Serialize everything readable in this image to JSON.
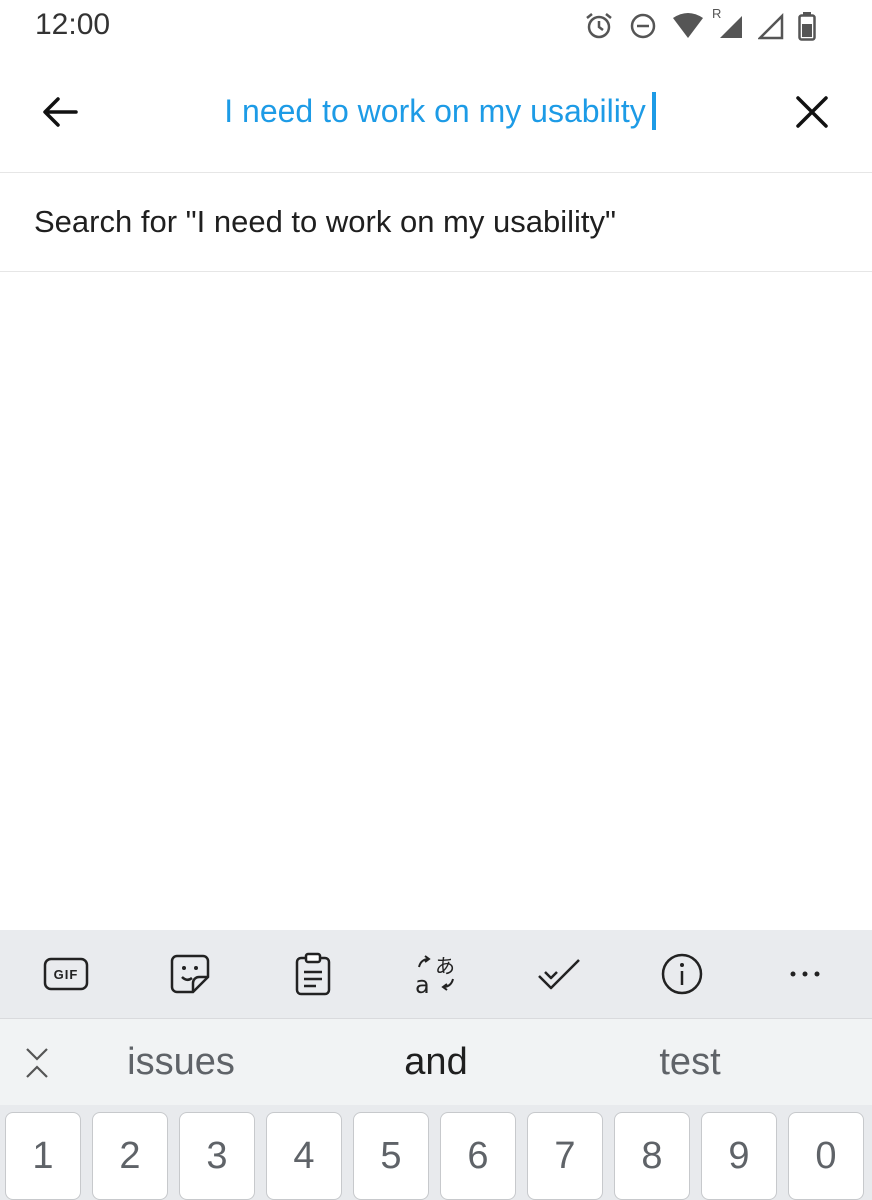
{
  "status_bar": {
    "time": "12:00",
    "icons": [
      "alarm-icon",
      "do-not-disturb-icon",
      "wifi-icon",
      "signal-roaming-icon",
      "signal-icon",
      "battery-icon"
    ],
    "roaming_label": "R"
  },
  "app_bar": {
    "search_value": "I need to work on my usability",
    "back_icon": "arrow-left-icon",
    "clear_icon": "close-icon",
    "accent_color": "#1d9be6"
  },
  "suggestion": {
    "label": "Search for \"I need to work on my usability\""
  },
  "keyboard": {
    "toolbar": {
      "gif_label": "GIF",
      "icons": [
        "gif-icon",
        "sticker-icon",
        "clipboard-icon",
        "translate-icon",
        "spellcheck-icon",
        "info-icon",
        "more-icon"
      ]
    },
    "suggestions": [
      "issues",
      "and",
      "test"
    ],
    "number_keys": [
      "1",
      "2",
      "3",
      "4",
      "5",
      "6",
      "7",
      "8",
      "9",
      "0"
    ]
  }
}
